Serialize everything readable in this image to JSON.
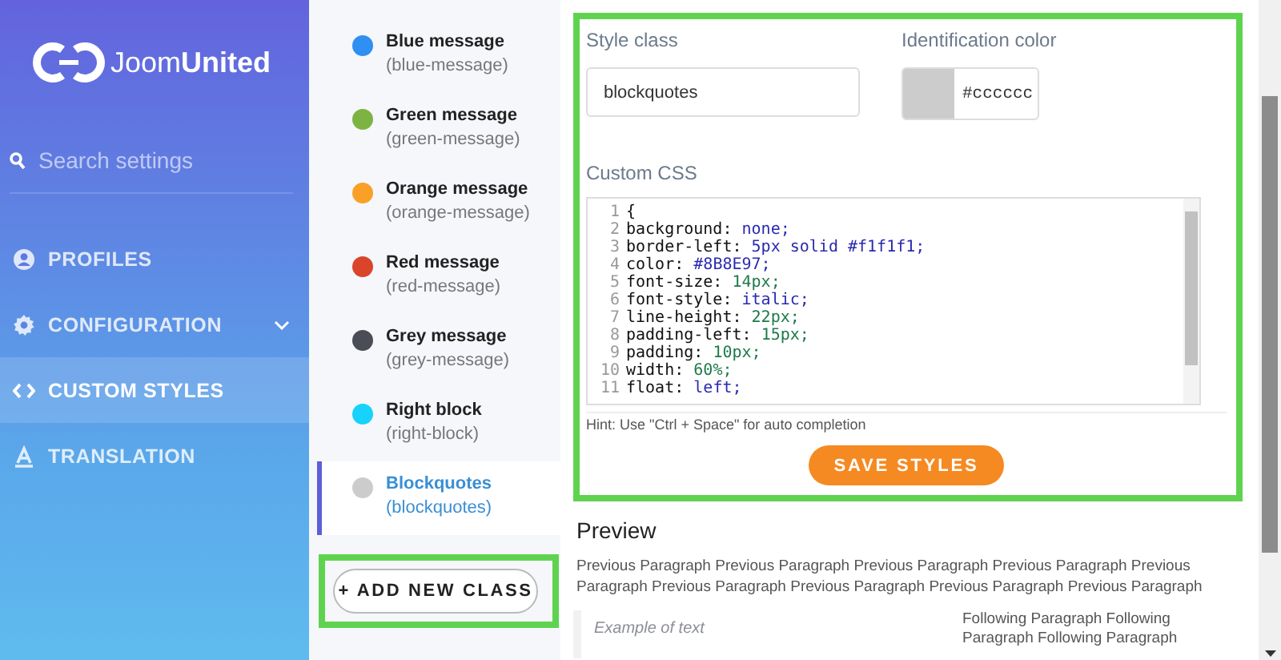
{
  "sidebar": {
    "logo": {
      "light": "Joom",
      "bold": "United"
    },
    "search": {
      "placeholder": "Search settings"
    },
    "items": [
      {
        "label": "PROFILES",
        "kind": "user",
        "selected": false
      },
      {
        "label": "CONFIGURATION",
        "kind": "gear",
        "selected": false,
        "expandable": true
      },
      {
        "label": "CUSTOM STYLES",
        "kind": "code",
        "selected": true
      },
      {
        "label": "TRANSLATION",
        "kind": "text",
        "selected": false
      }
    ]
  },
  "classes": {
    "items": [
      {
        "name": "Blue message",
        "slug": "(blue-message)",
        "color": "#2f8ff2",
        "selected": false
      },
      {
        "name": "Green message",
        "slug": "(green-message)",
        "color": "#7cb342",
        "selected": false
      },
      {
        "name": "Orange message",
        "slug": "(orange-message)",
        "color": "#f9a027",
        "selected": false
      },
      {
        "name": "Red message",
        "slug": "(red-message)",
        "color": "#d9442b",
        "selected": false
      },
      {
        "name": "Grey message",
        "slug": "(grey-message)",
        "color": "#4a4d55",
        "selected": false
      },
      {
        "name": "Right block",
        "slug": "(right-block)",
        "color": "#17d2fb",
        "selected": false
      },
      {
        "name": "Blockquotes",
        "slug": "(blockquotes)",
        "color": "#cccccc",
        "selected": true
      }
    ],
    "add_button": "+ ADD NEW CLASS"
  },
  "editor": {
    "style_class_label": "Style class",
    "style_class_value": "blockquotes",
    "color_label": "Identification color",
    "color_value": "#cccccc",
    "color": "#cccccc",
    "css_label": "Custom CSS",
    "code_lines": [
      {
        "num": "1",
        "text": "{"
      },
      {
        "num": "2",
        "text": "background:",
        "value": "none;",
        "kind": "keyword"
      },
      {
        "num": "3",
        "text": "border-left:",
        "value": "5px solid #f1f1f1;",
        "kind": "keyword"
      },
      {
        "num": "4",
        "text": "color:",
        "value": "#8B8E97;",
        "kind": "keyword"
      },
      {
        "num": "5",
        "text": "font-size:",
        "value": "14px;",
        "kind": "number"
      },
      {
        "num": "6",
        "text": "font-style:",
        "value": "italic;",
        "kind": "keyword"
      },
      {
        "num": "7",
        "text": "line-height:",
        "value": "22px;",
        "kind": "number"
      },
      {
        "num": "8",
        "text": "padding-left:",
        "value": "15px;",
        "kind": "number"
      },
      {
        "num": "9",
        "text": "padding:",
        "value": "10px;",
        "kind": "number"
      },
      {
        "num": "10",
        "text": "width:",
        "value": "60%;",
        "kind": "number"
      },
      {
        "num": "11",
        "text": "float:",
        "value": "left;",
        "kind": "keyword"
      }
    ],
    "hint": "Hint: Use \"Ctrl + Space\" for auto completion",
    "save_button": "SAVE STYLES"
  },
  "preview": {
    "title": "Preview",
    "previous": "Previous Paragraph Previous Paragraph Previous Paragraph Previous Paragraph Previous Paragraph Previous Paragraph Previous Paragraph Previous Paragraph Previous Paragraph",
    "example": "Example of text",
    "following": "Following Paragraph Following Paragraph Following Paragraph"
  }
}
